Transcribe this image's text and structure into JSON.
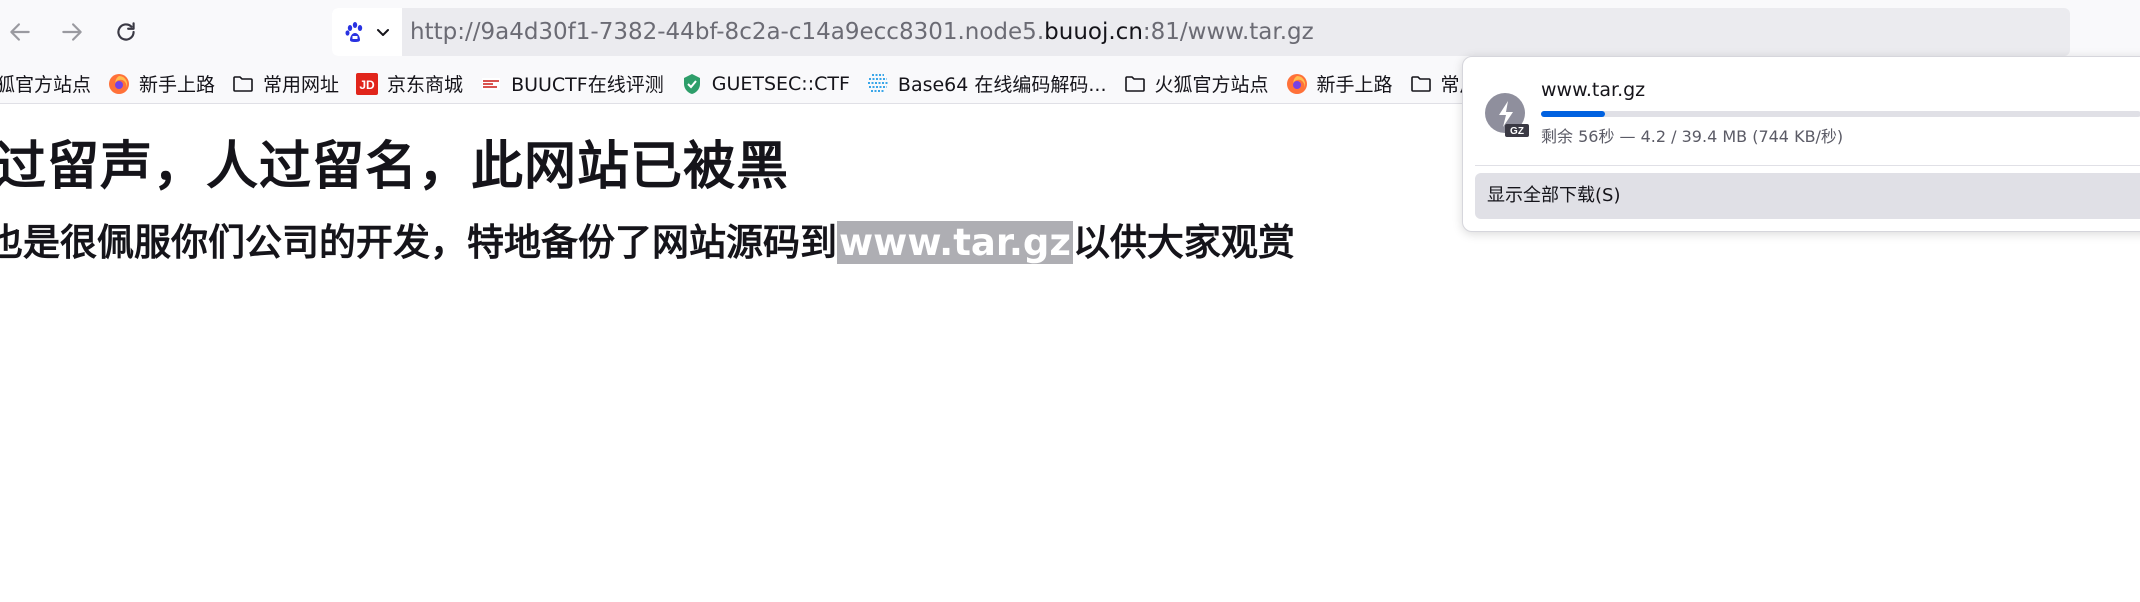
{
  "url": {
    "prefix": "http://9a4d30f1-7382-44bf-8c2a-c14a9ecc8301.node5.",
    "domain": "buuoj.cn",
    "suffix": ":81/www.tar.gz"
  },
  "bookmarks": [
    {
      "label": "狐官方站点",
      "icon": "firefox-icon"
    },
    {
      "label": "新手上路",
      "icon": "firefox-icon"
    },
    {
      "label": "常用网址",
      "icon": "folder-icon"
    },
    {
      "label": "京东商城",
      "icon": "jd-icon"
    },
    {
      "label": "BUUCTF在线评测",
      "icon": "buuctf-icon"
    },
    {
      "label": "GUETSEC::CTF",
      "icon": "guetsec-icon"
    },
    {
      "label": "Base64 在线编码解码...",
      "icon": "base64-icon"
    },
    {
      "label": "火狐官方站点",
      "icon": "folder-icon"
    },
    {
      "label": "新手上路",
      "icon": "firefox-icon"
    },
    {
      "label": "常用网址",
      "icon": "folder-icon"
    }
  ],
  "page": {
    "heading": "过留声，人过留名，此网站已被黑",
    "line_before": "也是很佩服你们公司的开发，特地备份了网站源码到",
    "line_highlight": "www.tar.gz",
    "line_after": "以供大家观赏"
  },
  "download": {
    "filename": "www.tar.gz",
    "status": "剩余 56秒 — 4.2 / 39.4 MB (744 KB/秒)",
    "progress": 0.107,
    "icon_label": "GZ",
    "show_all_label": "显示全部下载(S)"
  },
  "colors": {
    "accent": "#0061e0",
    "highlight": "#aeaeb3"
  }
}
